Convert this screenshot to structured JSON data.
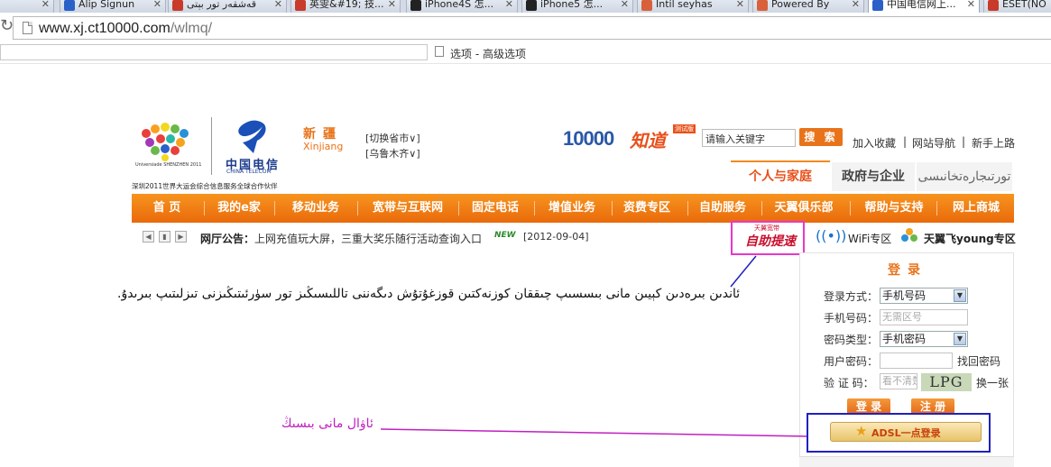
{
  "browser": {
    "tabs": [
      {
        "label": "",
        "favicon_color": "#4a8ad8"
      },
      {
        "label": "Alip Signun",
        "favicon_color": "#2a60c8"
      },
      {
        "label": "قەشقەر تور بېتى",
        "favicon_color": "#c83a2a"
      },
      {
        "label": "英雯&#19; 技...",
        "favicon_color": "#c83a2a"
      },
      {
        "label": "iPhone4S 怎...",
        "favicon_color": "#222222"
      },
      {
        "label": "iPhone5 怎...",
        "favicon_color": "#222222"
      },
      {
        "label": "Intil seyhas",
        "favicon_color": "#d8603a"
      },
      {
        "label": "Powered By",
        "favicon_color": "#d8603a"
      },
      {
        "label": "中国电信网上...",
        "favicon_color": "#2a60c8"
      },
      {
        "label": "ESET(NO",
        "favicon_color": "#c83a2a"
      }
    ],
    "url_host": "www.xj.ct10000.com",
    "url_path": "/wlmq/",
    "infobar_text": "选项 - 高级选项"
  },
  "header": {
    "unisersiade_caption": "Universiade SHENZHEN 2011",
    "ct_name_cn": "中国电信",
    "ct_name_en": "CHINA TELECOM",
    "sponsor_text": "深圳2011世界大运会综合信息服务全球合作伙伴",
    "region_cn": "新疆",
    "region_en": "Xinjiang",
    "switch_province": "[切换省市∨]",
    "switch_city": "[乌鲁木齐∨]",
    "logo_10000": "10000",
    "logo_zhidao": "知道",
    "beta_tag": "测试版",
    "search_value": "请输入关键字",
    "search_button": "搜 索",
    "top_links": [
      "加入收藏",
      "网站导航",
      "新手上路"
    ]
  },
  "segments": {
    "personal": "个人与家庭",
    "gov": "政府与企业",
    "biz": "تورتىجارەتخانىسى"
  },
  "nav": [
    "首 页",
    "我的e家",
    "移动业务",
    "宽带与互联网",
    "固定电话",
    "增值业务",
    "资费专区",
    "自助服务",
    "天翼俱乐部",
    "帮助与支持",
    "网上商城"
  ],
  "notice": {
    "prev_arrow": "◀",
    "pause_arrow": "▮",
    "next_arrow": "▶",
    "label": "网厅公告：",
    "text": "上网充值玩大屏，三重大奖乐随行活动查询入口",
    "new_badge": "NEW",
    "date": "[2012-09-04]"
  },
  "quick": {
    "selfhelp_small": "天翼宽带",
    "selfhelp_big": "自助提速",
    "wifi_icon": "((•))",
    "wifi_label": "WiFi专区",
    "young_label": "天翼飞young专区"
  },
  "login": {
    "title": "登录",
    "method_label": "登录方式：",
    "method_value": "手机号码",
    "phone_label": "手机号码：",
    "phone_placeholder": "无需区号",
    "pwtype_label": "密码类型：",
    "pwtype_value": "手机密码",
    "password_label": "用户密码：",
    "forgot": "找回密码",
    "captcha_label": "验 证 码：",
    "captcha_placeholder": "看不清楚输入",
    "captcha_text": "LPG",
    "refresh": "换一张",
    "login_button": "登 录",
    "register_button": "注 册",
    "adsl_button": "ADSL一点登录",
    "dropdown_glyph": "▼"
  },
  "annotations": {
    "arrow_note": "ئاندىن  بىرەدىن كېيىن مانى بىسسىپ چىققان كوزنەكتىن قوزغۇتۇش دىگەننى تاللىسىڭىز تور سۈرئىتىڭىزنى تىزلىتىپ بىرىدۇ.",
    "box_note": "ئاۋال مانى بىسىڭ",
    "colors": {
      "magenta": "#e838c8",
      "blue": "#2020c0",
      "orange": "#e8731a",
      "nav_orange": "#f28a1e"
    }
  }
}
